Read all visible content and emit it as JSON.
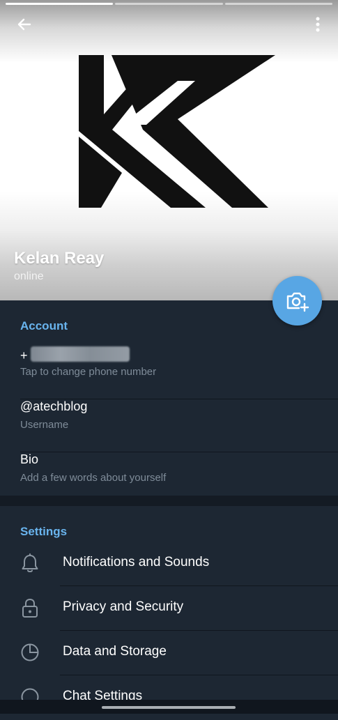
{
  "header": {
    "name": "Kelan Reay",
    "status": "online"
  },
  "account": {
    "title": "Account",
    "phone_prefix": "+",
    "phone_hint": "Tap to change phone number",
    "username": "@atechblog",
    "username_hint": "Username",
    "bio_label": "Bio",
    "bio_hint": "Add a few words about yourself"
  },
  "settings": {
    "title": "Settings",
    "items": [
      {
        "label": "Notifications and Sounds",
        "icon": "bell-icon"
      },
      {
        "label": "Privacy and Security",
        "icon": "lock-icon"
      },
      {
        "label": "Data and Storage",
        "icon": "pie-chart-icon"
      },
      {
        "label": "Chat Settings",
        "icon": "chat-bubble-icon"
      }
    ]
  },
  "colors": {
    "background": "#1d2733",
    "accent": "#69b4ee",
    "fab": "#58a6e4",
    "hint_text": "#7f8c99"
  }
}
